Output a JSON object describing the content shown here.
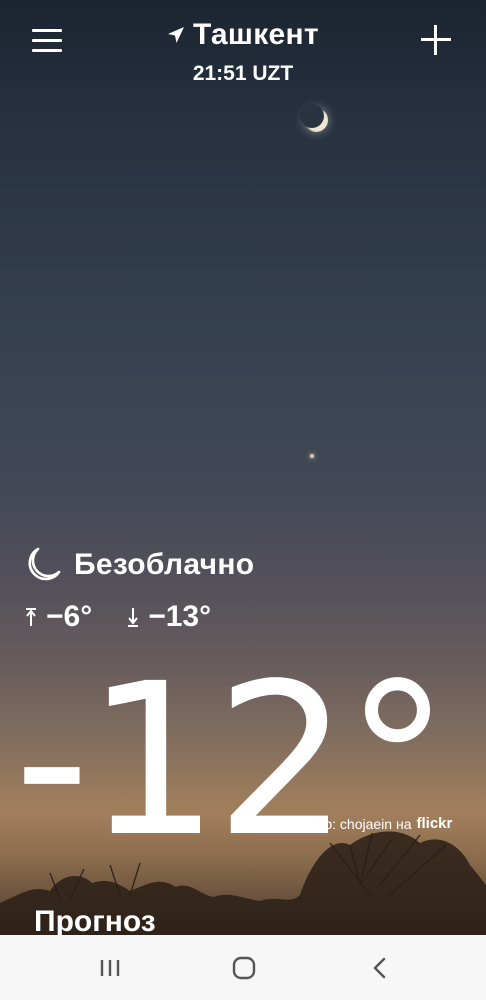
{
  "header": {
    "city": "Ташкент",
    "time": "21:51 UZT",
    "menu_icon": "hamburger-menu-icon",
    "add_icon": "plus-icon",
    "location_icon": "location-arrow-icon"
  },
  "current": {
    "condition": "Безоблачно",
    "condition_icon": "crescent-moon-icon",
    "high": "−6°",
    "low": "−13°",
    "temperature": "-12°"
  },
  "credit": {
    "symbol": "©",
    "text": "Автор: chojaein на",
    "brand": "flickr"
  },
  "section": {
    "forecast_title": "Прогноз"
  },
  "navbar": {
    "recent_icon": "recent-apps-icon",
    "home_icon": "home-icon",
    "back_icon": "back-icon",
    "background": "#f7f7f7"
  }
}
